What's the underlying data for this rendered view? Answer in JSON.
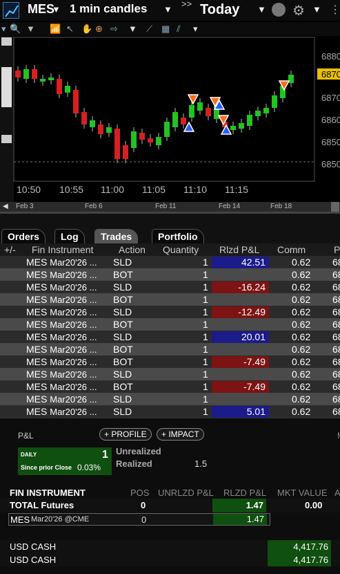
{
  "header": {
    "symbol": "MES",
    "interval": "1 min candles",
    "range": "Today",
    "more": ">>"
  },
  "chart": {
    "price_labels": [
      "6880",
      "6870",
      "6860",
      "6850",
      "6850"
    ],
    "current_price": "6870",
    "time_labels": [
      "10:50",
      "10:55",
      "11:00",
      "11:05",
      "11:10",
      "11:15"
    ],
    "date_labels": [
      "Feb 3",
      "Feb 6",
      "Feb 11",
      "Feb 14",
      "Feb 18"
    ],
    "colors": {
      "up": "#22c322",
      "down": "#d62020",
      "current": "#e8c000"
    }
  },
  "tabs": [
    "Orders",
    "Log",
    "Trades",
    "Portfolio"
  ],
  "active_tab": "Trades",
  "table": {
    "headers": [
      "+/-",
      "Fin Instrument",
      "Action",
      "Quantity",
      "Rlzd P&L",
      "Comm",
      "P"
    ],
    "rows": [
      {
        "sym": "MES",
        "exp": "Mar20'26 ...",
        "action": "SLD",
        "qty": "1",
        "pnl": "42.51",
        "comm": "0.62",
        "p": "68"
      },
      {
        "sym": "MES",
        "exp": "Mar20'26 ...",
        "action": "BOT",
        "qty": "1",
        "pnl": "",
        "comm": "0.62",
        "p": "68"
      },
      {
        "sym": "MES",
        "exp": "Mar20'26 ...",
        "action": "SLD",
        "qty": "1",
        "pnl": "-16.24",
        "comm": "0.62",
        "p": "68"
      },
      {
        "sym": "MES",
        "exp": "Mar20'26 ...",
        "action": "BOT",
        "qty": "1",
        "pnl": "",
        "comm": "0.62",
        "p": "68"
      },
      {
        "sym": "MES",
        "exp": "Mar20'26 ...",
        "action": "SLD",
        "qty": "1",
        "pnl": "-12.49",
        "comm": "0.62",
        "p": "68"
      },
      {
        "sym": "MES",
        "exp": "Mar20'26 ...",
        "action": "BOT",
        "qty": "1",
        "pnl": "",
        "comm": "0.62",
        "p": "68"
      },
      {
        "sym": "MES",
        "exp": "Mar20'26 ...",
        "action": "SLD",
        "qty": "1",
        "pnl": "20.01",
        "comm": "0.62",
        "p": "68"
      },
      {
        "sym": "MES",
        "exp": "Mar20'26 ...",
        "action": "BOT",
        "qty": "1",
        "pnl": "",
        "comm": "0.62",
        "p": "68"
      },
      {
        "sym": "MES",
        "exp": "Mar20'26 ...",
        "action": "BOT",
        "qty": "1",
        "pnl": "-7.49",
        "comm": "0.62",
        "p": "68"
      },
      {
        "sym": "MES",
        "exp": "Mar20'26 ...",
        "action": "SLD",
        "qty": "1",
        "pnl": "",
        "comm": "0.62",
        "p": "68"
      },
      {
        "sym": "MES",
        "exp": "Mar20'26 ...",
        "action": "BOT",
        "qty": "1",
        "pnl": "-7.49",
        "comm": "0.62",
        "p": "68"
      },
      {
        "sym": "MES",
        "exp": "Mar20'26 ...",
        "action": "SLD",
        "qty": "1",
        "pnl": "",
        "comm": "0.62",
        "p": "68"
      },
      {
        "sym": "MES",
        "exp": "Mar20'26 ...",
        "action": "SLD",
        "qty": "1",
        "pnl": "5.01",
        "comm": "0.62",
        "p": "68"
      }
    ]
  },
  "pnl_panel": {
    "title": "P&L",
    "profile_btn": "+ PROFILE",
    "impact_btn": "+ IMPACT",
    "daily_label": "DAILY",
    "daily_value": "1",
    "since_label": "Since prior Close",
    "since_value": "0.03%",
    "unrealized_label": "Unrealized",
    "realized_label": "Realized",
    "realized_value": "1.5"
  },
  "portfolio": {
    "headers": [
      "FIN INSTRUMENT",
      "POS",
      "UNRLZD P&L",
      "RLZD P&L",
      "MKT VALUE",
      "A"
    ],
    "total_label": "TOTAL Futures",
    "total_pos": "0",
    "total_rlzd": "1.47",
    "total_mkt": "0.00",
    "mes_sym": "MES",
    "mes_detail": "Mar20'26 @CME",
    "mes_pos": "0",
    "mes_rlzd": "1.47",
    "cash1_label": "USD CASH",
    "cash1_value": "4,417.76",
    "cash2_label": "USD CASH",
    "cash2_value": "4,417.76"
  }
}
